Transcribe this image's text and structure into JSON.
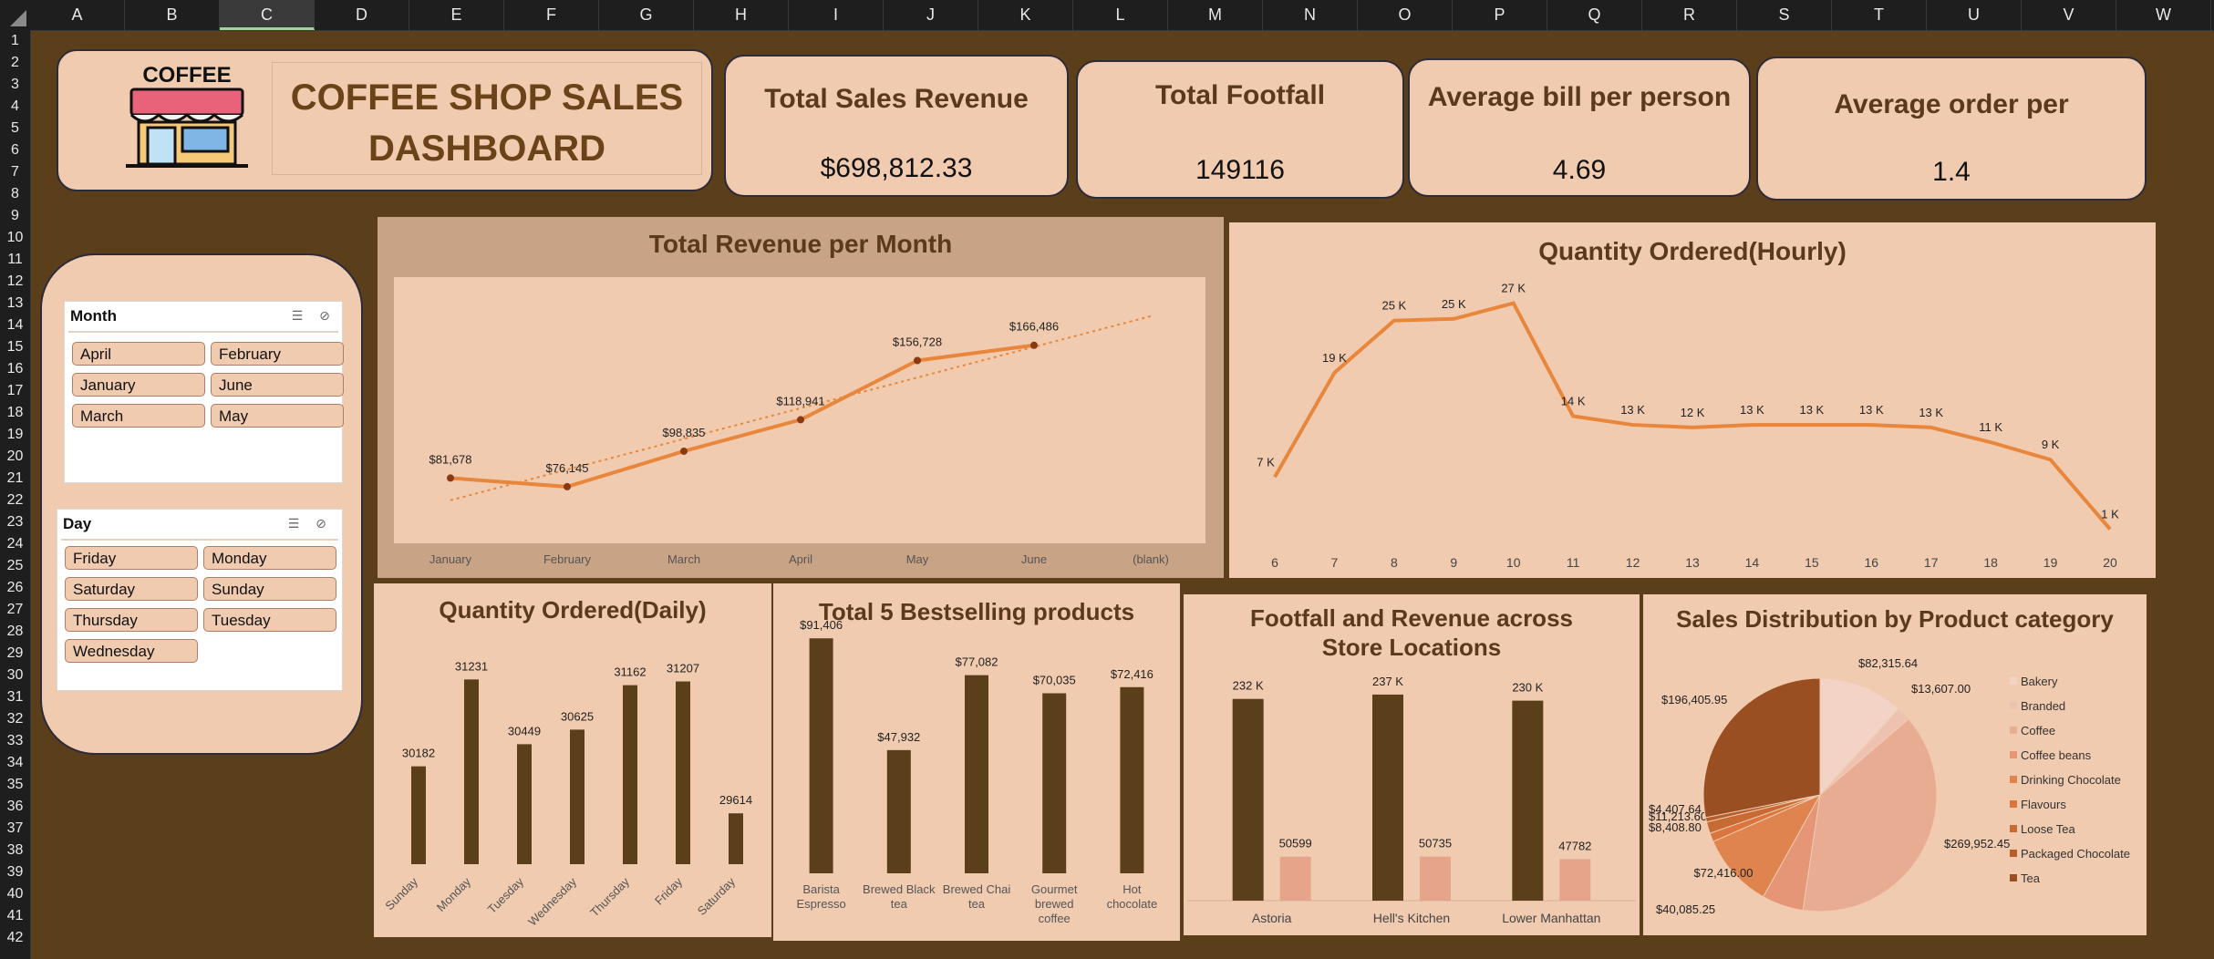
{
  "sheet": {
    "columns": [
      "A",
      "B",
      "C",
      "D",
      "E",
      "F",
      "G",
      "H",
      "I",
      "J",
      "K",
      "L",
      "M",
      "N",
      "O",
      "P",
      "Q",
      "R",
      "S",
      "T",
      "U",
      "V",
      "W"
    ],
    "selected_column": "C",
    "rows": [
      "1",
      "2",
      "3",
      "4",
      "5",
      "6",
      "7",
      "8",
      "9",
      "10",
      "11",
      "12",
      "13",
      "14",
      "15",
      "16",
      "17",
      "18",
      "19",
      "20",
      "21",
      "22",
      "23",
      "24",
      "25",
      "26",
      "27",
      "28",
      "29",
      "30",
      "31",
      "32",
      "33",
      "34",
      "35",
      "36",
      "37",
      "38",
      "39",
      "40",
      "41",
      "42"
    ]
  },
  "header": {
    "logo_text": "COFFEE",
    "title_line1": "COFFEE SHOP SALES",
    "title_line2": "DASHBOARD"
  },
  "kpis": [
    {
      "title": "Total Sales Revenue",
      "value": "$698,812.33"
    },
    {
      "title": "Total Footfall",
      "value": "149116"
    },
    {
      "title": "Average bill per person",
      "value": "4.69"
    },
    {
      "title": "Average order per",
      "value": "1.4"
    }
  ],
  "slicers": {
    "month": {
      "title": "Month",
      "items": [
        "April",
        "February",
        "January",
        "June",
        "March",
        "May"
      ]
    },
    "day": {
      "title": "Day",
      "items": [
        "Friday",
        "Monday",
        "Saturday",
        "Sunday",
        "Thursday",
        "Tuesday",
        "Wednesday"
      ]
    }
  },
  "colors": {
    "background": "#5b3f1a",
    "card": "#f0cbb0",
    "bar_dark": "#5b3f1a",
    "bar_light": "#e6a58a",
    "line": "#e8863b"
  },
  "chart_data": [
    {
      "id": "revenue_month",
      "type": "line",
      "title": "Total Revenue per Month",
      "categories": [
        "January",
        "February",
        "March",
        "April",
        "May",
        "June",
        "(blank)"
      ],
      "values": [
        81678,
        76145,
        98835,
        118941,
        156728,
        166486,
        null
      ],
      "data_labels": [
        "$81,678",
        "$76,145",
        "$98,835",
        "$118,941",
        "$156,728",
        "$166,486",
        ""
      ],
      "trendline": true,
      "ylim": [
        40000,
        210000
      ]
    },
    {
      "id": "qty_hourly",
      "type": "line",
      "title": "Quantity Ordered(Hourly)",
      "categories": [
        "6",
        "7",
        "8",
        "9",
        "10",
        "11",
        "12",
        "13",
        "14",
        "15",
        "16",
        "17",
        "18",
        "19",
        "20"
      ],
      "values": [
        7,
        19,
        25,
        25.2,
        27,
        14,
        13,
        12.7,
        13,
        13,
        13,
        12.7,
        11,
        9,
        1
      ],
      "data_labels": [
        "7 K",
        "19 K",
        "25 K",
        "25 K",
        "27 K",
        "14 K",
        "13 K",
        "12 K",
        "13 K",
        "13 K",
        "13 K",
        "13 K",
        "11 K",
        "9 K",
        "1 K"
      ],
      "ylim": [
        0,
        30
      ]
    },
    {
      "id": "qty_daily",
      "type": "bar",
      "title": "Quantity Ordered(Daily)",
      "categories": [
        "Sunday",
        "Monday",
        "Tuesday",
        "Wednesday",
        "Thursday",
        "Friday",
        "Saturday"
      ],
      "values": [
        30182,
        31231,
        30449,
        30625,
        31162,
        31207,
        29614
      ],
      "data_labels": [
        "30182",
        "31231",
        "30449",
        "30625",
        "31162",
        "31207",
        "29614"
      ],
      "ylim": [
        29000,
        31400
      ]
    },
    {
      "id": "top5",
      "type": "bar",
      "title": "Total 5 Bestselling products",
      "categories": [
        "Barista Espresso",
        "Brewed Black tea",
        "Brewed Chai tea",
        "Gourmet brewed coffee",
        "Hot chocolate"
      ],
      "values": [
        91406,
        47932,
        77082,
        70035,
        72416
      ],
      "data_labels": [
        "$91,406",
        "$47,932",
        "$77,082",
        "$70,035",
        "$72,416"
      ],
      "ylim": [
        0,
        100000
      ]
    },
    {
      "id": "store",
      "type": "bar",
      "title": "Footfall and Revenue across Store Locations",
      "categories": [
        "Astoria",
        "Hell's Kitchen",
        "Lower Manhattan"
      ],
      "series": [
        {
          "values": [
            232000,
            237000,
            230000
          ],
          "labels": [
            "232 K",
            "237 K",
            "230 K"
          ]
        },
        {
          "values": [
            50599,
            50735,
            47782
          ],
          "labels": [
            "50599",
            "50735",
            "47782"
          ]
        }
      ],
      "ylim": [
        0,
        260000
      ]
    },
    {
      "id": "category",
      "type": "pie",
      "title": "Sales Distribution by Product category",
      "categories": [
        "Bakery",
        "Branded",
        "Coffee",
        "Coffee beans",
        "Drinking Chocolate",
        "Flavours",
        "Loose Tea",
        "Packaged Chocolate",
        "Tea"
      ],
      "values": [
        82315.64,
        13607.0,
        269952.45,
        40085.25,
        72416.0,
        8408.8,
        11213.6,
        4407.64,
        196405.95
      ],
      "data_labels": [
        "$82,315.64",
        "$13,607.00",
        "$269,952.45",
        "$40,085.25",
        "$72,416.00",
        "$8,408.80",
        "$11,213.60",
        "$4,407.64",
        "$196,405.95"
      ],
      "colors": [
        "#f2d3c6",
        "#eec2b0",
        "#e8ac93",
        "#e59676",
        "#e0844f",
        "#d9753d",
        "#c86a33",
        "#b55f2c",
        "#9a4f22"
      ],
      "legend": "right"
    }
  ]
}
